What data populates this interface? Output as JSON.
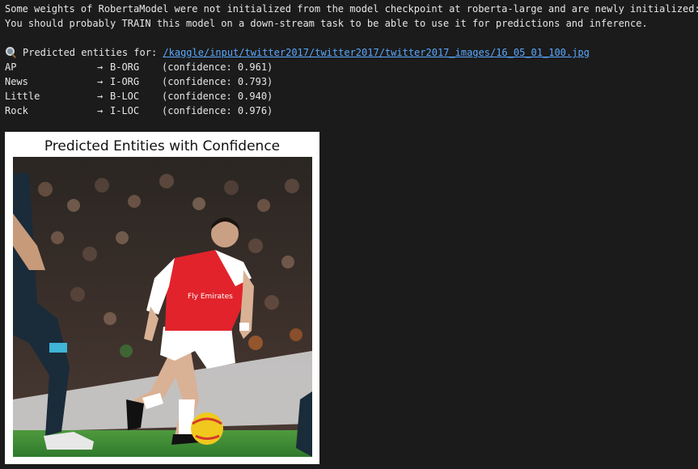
{
  "console": {
    "warning_line_1": "Some weights of RobertaModel were not initialized from the model checkpoint at roberta-large and are newly initialized: [",
    "warning_line_2": "You should probably TRAIN this model on a down-stream task to be able to use it for predictions and inference.",
    "predicted_label": "Predicted entities for: ",
    "image_path": "/kaggle/input/twitter2017/twitter2017/twitter2017_images/16_05_01_100.jpg",
    "icon": "magnifying-glass-icon"
  },
  "entities": [
    {
      "token": "AP",
      "arrow": "→",
      "tag": "B-ORG",
      "confidence": "(confidence: 0.961)"
    },
    {
      "token": "News",
      "arrow": "→",
      "tag": "I-ORG",
      "confidence": "(confidence: 0.793)"
    },
    {
      "token": "Little",
      "arrow": "→",
      "tag": "B-LOC",
      "confidence": "(confidence: 0.940)"
    },
    {
      "token": "Rock",
      "arrow": "→",
      "tag": "I-LOC",
      "confidence": "(confidence: 0.976)"
    }
  ],
  "figure": {
    "title": "Predicted Entities with Confidence",
    "photo_text": "Fly Emirates"
  },
  "colors": {
    "background": "#1b1b1b",
    "text": "#e6e6e6",
    "link": "#5aa9ff",
    "figure_bg": "#ffffff"
  }
}
